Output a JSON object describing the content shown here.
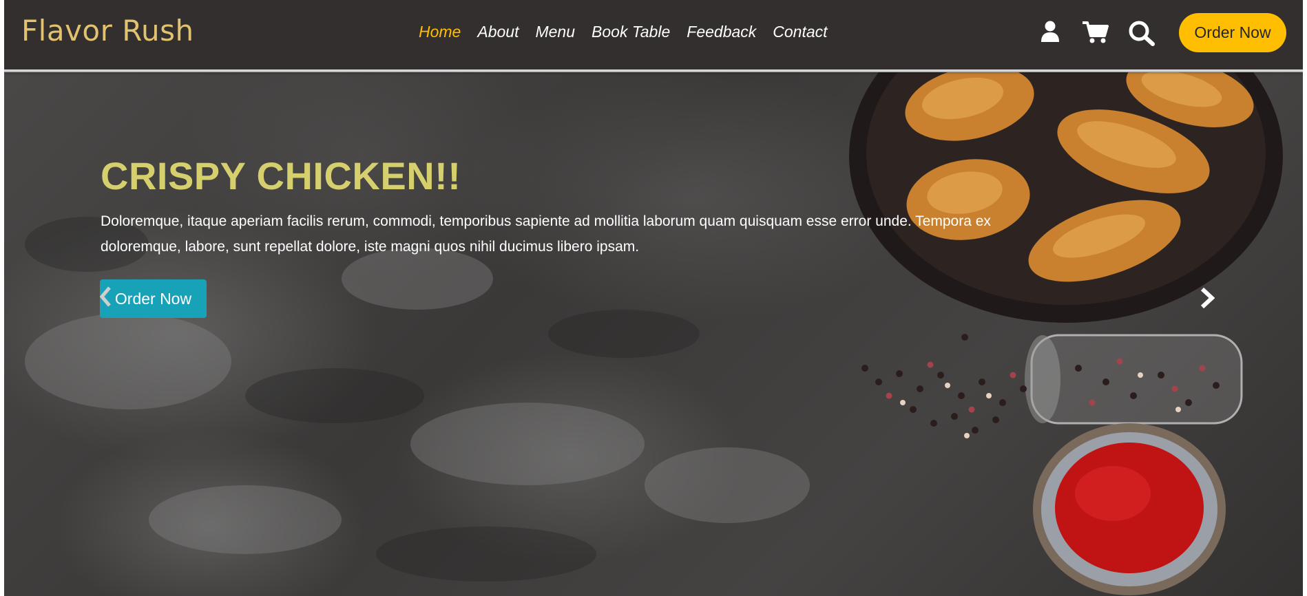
{
  "brand": {
    "name": "Flavor Rush",
    "color": "#e0c270"
  },
  "nav": {
    "links": [
      {
        "label": "Home",
        "active": true
      },
      {
        "label": "About"
      },
      {
        "label": "Menu"
      },
      {
        "label": "Book Table"
      },
      {
        "label": "Feedback"
      },
      {
        "label": "Contact"
      }
    ],
    "icons": [
      "user-icon",
      "cart-icon",
      "search-icon"
    ],
    "order_label": "Order Now",
    "accent_color": "#ffbe00"
  },
  "hero": {
    "title": "CRISPY CHICKEN!!",
    "text": "Doloremque, itaque aperiam facilis rerum, commodi, temporibus sapiente ad mollitia laborum quam quisquam esse error unde. Tempora ex doloremque, labore, sunt repellat dolore, iste magni quos nihil ducimus libero ipsam.",
    "button_label": "Order Now",
    "button_color": "#17a2b8",
    "title_color": "#d6cf6e",
    "controls": [
      "chevron-left-icon",
      "chevron-right-icon"
    ]
  }
}
